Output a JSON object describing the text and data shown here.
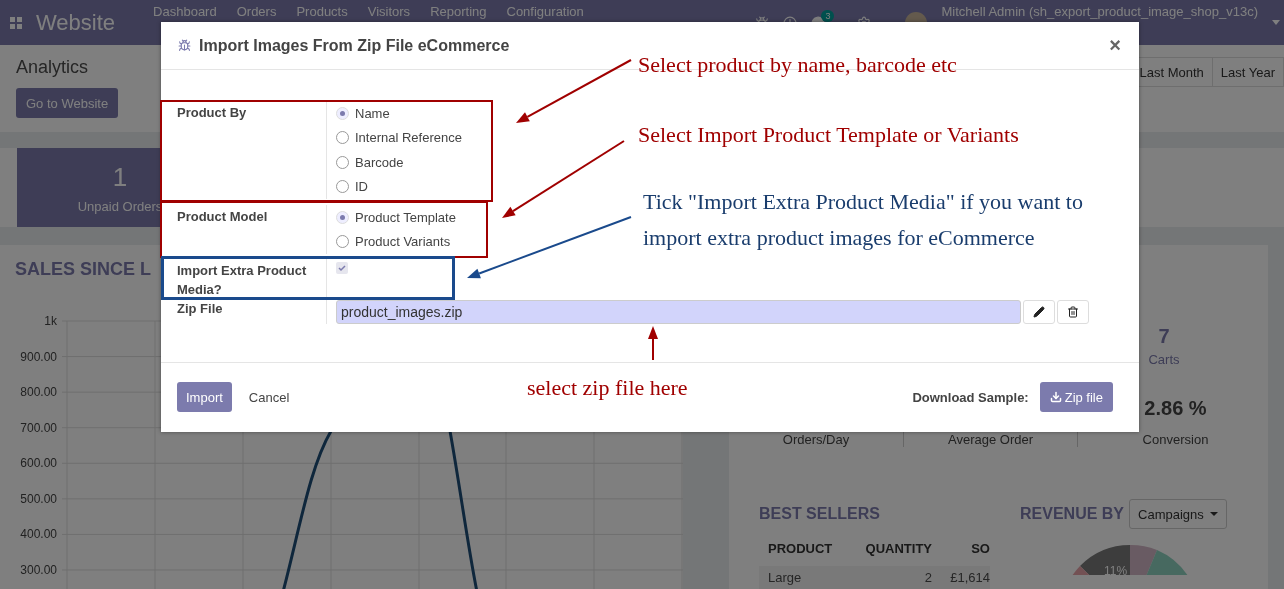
{
  "navbar": {
    "app_name": "Website",
    "menu": [
      "Dashboard",
      "Orders",
      "Products",
      "Visitors",
      "Reporting",
      "Configuration"
    ],
    "chat_count": "3",
    "user": "Mitchell Admin (sh_export_product_image_shop_v13c)"
  },
  "control_panel": {
    "title": "Analytics",
    "action": "Go to Website",
    "periods": [
      "Last Month",
      "Last Year"
    ]
  },
  "kpi": {
    "value": "1",
    "label": "Unpaid Orders"
  },
  "sales_chart": {
    "title": "SALES SINCE L",
    "axis_labels": [
      "1k",
      "900.00",
      "800.00",
      "700.00",
      "600.00",
      "500.00",
      "400.00",
      "300.00"
    ]
  },
  "stats": [
    {
      "value": "7",
      "label": "Carts"
    },
    {
      "label": "Orders/Day"
    },
    {
      "label": "Average Order"
    },
    {
      "value": "2.86 %",
      "label": "Conversion"
    }
  ],
  "best_sellers": {
    "title": "BEST SELLERS",
    "columns": [
      "PRODUCT",
      "QUANTITY",
      "SO"
    ],
    "rows": [
      [
        "Large",
        "2",
        "£1,614"
      ]
    ]
  },
  "revenue": {
    "title": "REVENUE BY",
    "dropdown": "Campaigns",
    "slice_label": "11%"
  },
  "dialog": {
    "title": "Import Images From Zip File eCommerce",
    "close": "×",
    "fields": [
      {
        "kind": "radio",
        "label": "Product By",
        "options": [
          {
            "label": "Name",
            "selected": true
          },
          {
            "label": "Internal Reference",
            "selected": false
          },
          {
            "label": "Barcode",
            "selected": false
          },
          {
            "label": "ID",
            "selected": false
          }
        ]
      },
      {
        "kind": "radio",
        "label": "Product Model",
        "options": [
          {
            "label": "Product Template",
            "selected": true
          },
          {
            "label": "Product Variants",
            "selected": false
          }
        ]
      },
      {
        "kind": "checkbox",
        "label": "Import Extra Product Media?",
        "checked": true
      },
      {
        "kind": "file",
        "label": "Zip File",
        "value": "product_images.zip"
      }
    ],
    "buttons": [
      {
        "label": "Import",
        "kind": "primary"
      },
      {
        "label": "Cancel",
        "kind": "link"
      }
    ],
    "download_label": "Download Sample:",
    "download_button": "Zip file"
  },
  "annotations": {
    "notes": [
      {
        "text": "Select product by name, barcode etc",
        "color": "#a00000"
      },
      {
        "text": "Select Import Product Template or Variants",
        "color": "#a00000"
      },
      {
        "text": "Tick \"Import Extra Product Media\" if you want to import extra product images for eCommerce",
        "color": "#1a3d6d"
      },
      {
        "text": "select zip file here",
        "color": "#a00000"
      }
    ],
    "boxes": [
      {
        "color": "#a00000"
      },
      {
        "color": "#a00000"
      },
      {
        "color": "#1a4a8c"
      }
    ],
    "arrows": [
      {
        "color": "#a00000"
      },
      {
        "color": "#a00000"
      },
      {
        "color": "#1a4a8c"
      },
      {
        "color": "#a00000"
      }
    ]
  }
}
